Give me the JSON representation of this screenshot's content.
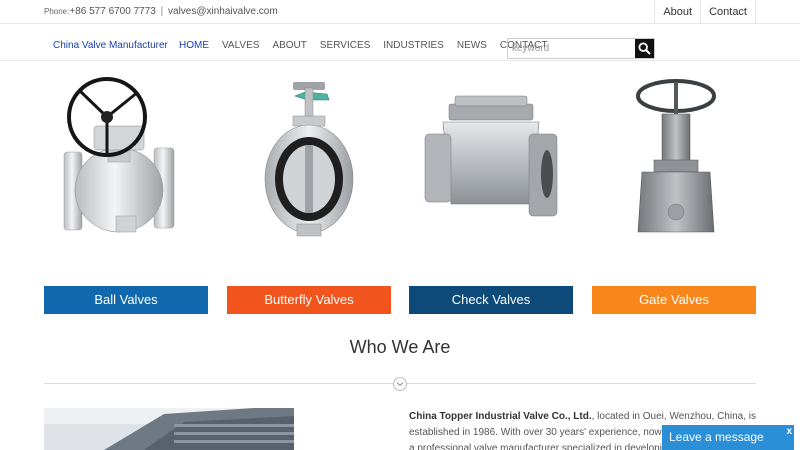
{
  "topbar": {
    "phone_label": "Phone:",
    "phone": "+86 577 6700 7773",
    "separator": "|",
    "email": "valves@xinhaivalve.com",
    "links": [
      "About",
      "Contact"
    ]
  },
  "nav": {
    "brand": "China Valve Manufacturer",
    "items": [
      "HOME",
      "VALVES",
      "ABOUT",
      "SERVICES",
      "INDUSTRIES",
      "NEWS",
      "CONTACT"
    ],
    "active": "HOME",
    "search_placeholder": "keyword"
  },
  "products": [
    {
      "label": "Ball Valves",
      "color": "#1168ad",
      "icon": "ball-valve-image"
    },
    {
      "label": "Butterfly Valves",
      "color": "#f2541d",
      "icon": "butterfly-valve-image"
    },
    {
      "label": "Check Valves",
      "color": "#0d4a7a",
      "icon": "check-valve-image"
    },
    {
      "label": "Gate Valves",
      "color": "#f8861a",
      "icon": "gate-valve-image"
    }
  ],
  "about": {
    "title": "Who We Are",
    "company": "China Topper Industrial Valve Co., Ltd.",
    "line1": ", located in Ouei, Wenzhou, China, is",
    "line2": "established in 1986. With over 30 years' experience, now, th",
    "line3": "a professional valve manufacturer specialized in developin"
  },
  "chat": {
    "label": "Leave a message",
    "close": "x"
  }
}
